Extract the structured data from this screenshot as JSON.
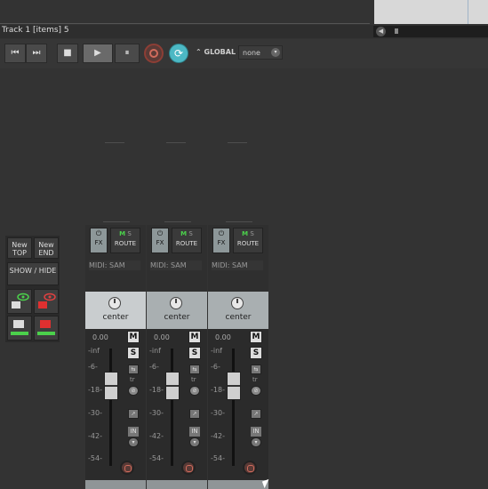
{
  "info": {
    "text": "Track 1 [items] 5"
  },
  "transport": {
    "buttons": [
      "⏮",
      "⏭",
      "■",
      "▶",
      "⏸"
    ],
    "loop_symbol": "⟳",
    "automation_label": "GLOBAL",
    "automation_mode": "none",
    "dropdown_glyph": "▾"
  },
  "side_buttons": {
    "new_top": "New TOP",
    "new_end": "New END",
    "show_hide": "SHOW / HIDE"
  },
  "strip_labels": {
    "fx": "FX",
    "power": "⏻",
    "route": "ROUTE",
    "m": "M",
    "s": "S",
    "midi": "MIDI: SAM",
    "pan": "center",
    "volume": "0.00",
    "mute": "M",
    "solo": "S",
    "tr": "tr",
    "in": "IN"
  },
  "meter_scale": [
    "-inf",
    "-6-",
    "-18-",
    "-30-",
    "-42-",
    "-54-"
  ],
  "colors": {
    "loop_accent": "#4cb8c4",
    "record": "#d06b5c",
    "selected_strip": "#c9cdcf",
    "strip": "#a9afb1",
    "ms_green": "#4bd14b"
  },
  "strips": [
    {
      "id": 1,
      "selected": true
    },
    {
      "id": 2,
      "selected": false
    },
    {
      "id": 3,
      "selected": false
    }
  ]
}
